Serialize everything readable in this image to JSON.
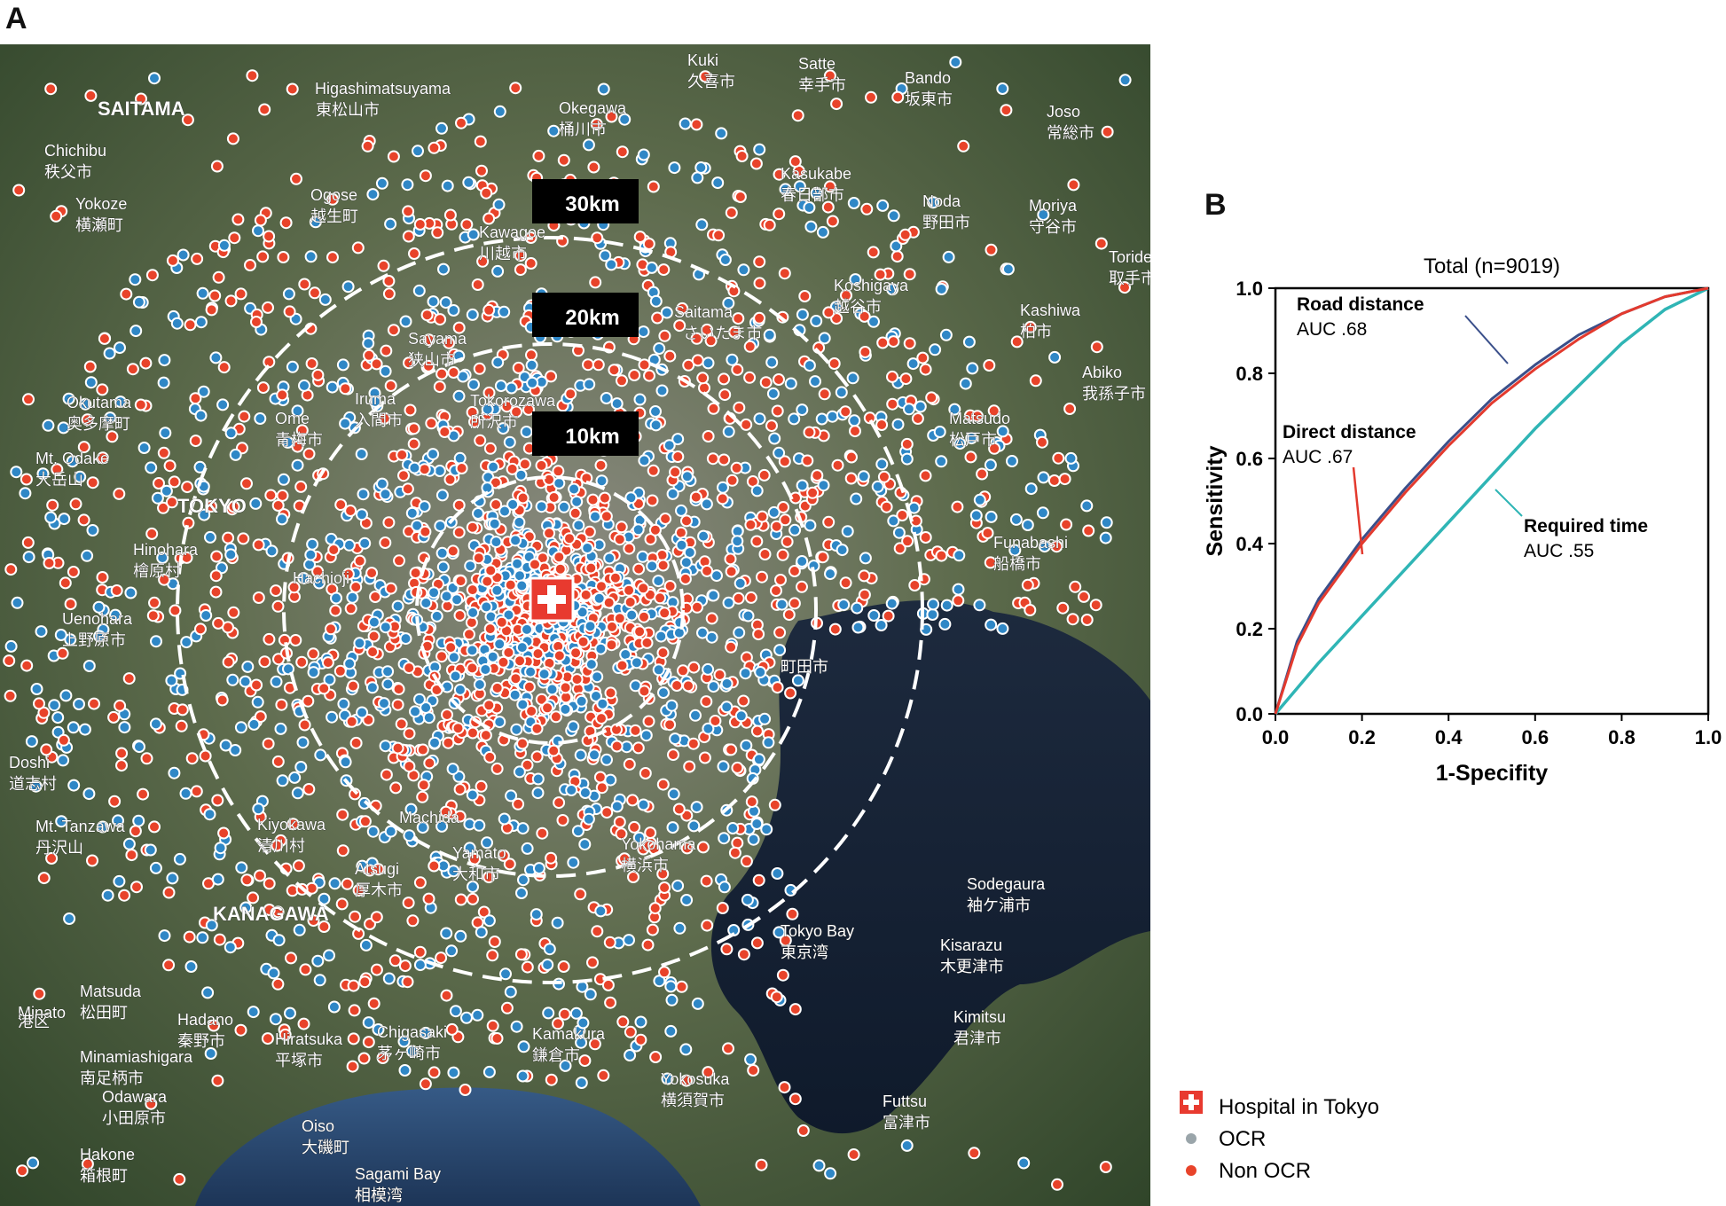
{
  "panels": {
    "a_label": "A",
    "b_label": "B"
  },
  "map": {
    "circle_labels": [
      "30km",
      "20km",
      "10km"
    ],
    "place_labels": [
      "SAITAMA",
      "Higashimatsuyama",
      "東松山市",
      "Kuki",
      "久喜市",
      "Satte",
      "幸手市",
      "Bando",
      "坂東市",
      "Joso",
      "常総市",
      "Chichibu",
      "秩父市",
      "Yokoze",
      "横瀬町",
      "Ogose",
      "越生町",
      "Okegawa",
      "桶川市",
      "Kasukabe",
      "春日部市",
      "Noda",
      "野田市",
      "Moriya",
      "守谷市",
      "Kawagoe",
      "川越市",
      "Koshigaya",
      "越谷市",
      "Toride",
      "取手市",
      "Saitama",
      "さいたま市",
      "Kashiwa",
      "柏市",
      "Sayama",
      "狭山市",
      "Abiko",
      "我孫子市",
      "Okutama",
      "奥多摩町",
      "Ome",
      "青梅市",
      "Iruma",
      "入間市",
      "Tokorozawa",
      "所沢市",
      "Matsudo",
      "松戸市",
      "Mt. Odake",
      "大岳山",
      "TOKYO",
      "Hinohara",
      "檜原村",
      "Funabashi",
      "船橋市",
      "Hachioji",
      "Uenohara",
      "上野原市",
      "Doshi",
      "道志村",
      "Kiyokawa",
      "清川村",
      "Mt. Tanzawa",
      "丹沢山",
      "Atsugi",
      "厚木市",
      "Yamato",
      "大和市",
      "Yokohama",
      "横浜市",
      "Sodegaura",
      "袖ケ浦市",
      "KANAGAWA",
      "Tokyo Bay",
      "東京湾",
      "Kisarazu",
      "木更津市",
      "Matsuda",
      "松田町",
      "Hadano",
      "秦野市",
      "Hiratsuka",
      "平塚市",
      "Chigasaki",
      "茅ヶ崎市",
      "Kamakura",
      "鎌倉市",
      "Kimitsu",
      "君津市",
      "Minamiashigara",
      "南足柄市",
      "Odawara",
      "小田原市",
      "Oiso",
      "大磯町",
      "Yokosuka",
      "横須賀市",
      "Futtsu",
      "富津市",
      "Hakone",
      "箱根町",
      "Sagami Bay",
      "相模湾",
      "Machida",
      "町田市",
      "Minato",
      "港区"
    ],
    "hospital_icon": "hospital-cross-icon"
  },
  "colors": {
    "ocr": "#2f87c6",
    "non_ocr": "#e8432a",
    "hospital": "#e83a2f",
    "road": "#3a4f8a",
    "direct": "#e33a2e",
    "time": "#2fb5b5"
  },
  "chart_data": {
    "type": "line",
    "title": "Total (n=9019)",
    "xlabel": "1-Specifity",
    "ylabel": "Sensitivity",
    "xlim": [
      0,
      1
    ],
    "ylim": [
      0,
      1
    ],
    "x_ticks": [
      "0.0",
      "0.2",
      "0.4",
      "0.6",
      "0.8",
      "1.0"
    ],
    "y_ticks": [
      "0.0",
      "0.2",
      "0.4",
      "0.6",
      "0.8",
      "1.0"
    ],
    "grid": false,
    "series": [
      {
        "name": "Road distance",
        "auc": "AUC .68",
        "x": [
          0,
          0.05,
          0.1,
          0.15,
          0.2,
          0.3,
          0.4,
          0.5,
          0.6,
          0.7,
          0.8,
          0.9,
          1.0
        ],
        "y": [
          0,
          0.17,
          0.27,
          0.34,
          0.41,
          0.53,
          0.64,
          0.74,
          0.82,
          0.89,
          0.94,
          0.98,
          1.0
        ]
      },
      {
        "name": "Direct distance",
        "auc": "AUC .67",
        "x": [
          0,
          0.05,
          0.1,
          0.15,
          0.2,
          0.3,
          0.4,
          0.5,
          0.6,
          0.7,
          0.8,
          0.9,
          1.0
        ],
        "y": [
          0,
          0.16,
          0.26,
          0.33,
          0.4,
          0.52,
          0.63,
          0.73,
          0.81,
          0.88,
          0.94,
          0.98,
          1.0
        ]
      },
      {
        "name": "Required time",
        "auc": "AUC .55",
        "x": [
          0,
          0.05,
          0.1,
          0.2,
          0.3,
          0.4,
          0.5,
          0.6,
          0.7,
          0.8,
          0.9,
          1.0
        ],
        "y": [
          0,
          0.06,
          0.12,
          0.23,
          0.34,
          0.45,
          0.56,
          0.67,
          0.77,
          0.87,
          0.95,
          1.0
        ]
      }
    ]
  },
  "legend": {
    "hospital": "Hospital in Tokyo",
    "ocr": "OCR",
    "non_ocr": "Non OCR"
  }
}
